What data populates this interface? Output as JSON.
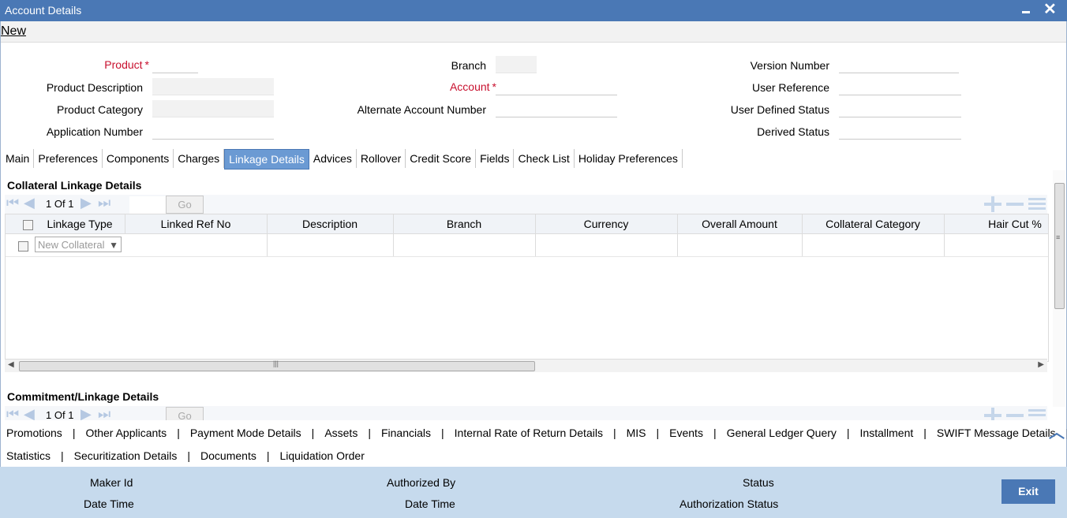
{
  "window": {
    "title": "Account Details"
  },
  "toolbar": {
    "new_label": "New"
  },
  "header_fields": {
    "product": {
      "label": "Product",
      "value": ""
    },
    "product_description": {
      "label": "Product Description",
      "value": ""
    },
    "product_category": {
      "label": "Product Category",
      "value": ""
    },
    "application_number": {
      "label": "Application Number",
      "value": ""
    },
    "branch": {
      "label": "Branch",
      "value": ""
    },
    "account": {
      "label": "Account",
      "value": ""
    },
    "alternate_account_number": {
      "label": "Alternate Account Number",
      "value": ""
    },
    "version_number": {
      "label": "Version Number",
      "value": ""
    },
    "user_reference": {
      "label": "User Reference",
      "value": ""
    },
    "user_defined_status": {
      "label": "User Defined Status",
      "value": ""
    },
    "derived_status": {
      "label": "Derived Status",
      "value": ""
    },
    "required_marker": "*"
  },
  "tabs": [
    {
      "label": "Main"
    },
    {
      "label": "Preferences"
    },
    {
      "label": "Components"
    },
    {
      "label": "Charges"
    },
    {
      "label": "Linkage Details",
      "active": true
    },
    {
      "label": "Advices"
    },
    {
      "label": "Rollover"
    },
    {
      "label": "Credit Score"
    },
    {
      "label": "Fields"
    },
    {
      "label": "Check List"
    },
    {
      "label": "Holiday Preferences"
    }
  ],
  "collateral": {
    "title": "Collateral Linkage Details",
    "page_current": "1",
    "page_of": "Of",
    "page_total": "1",
    "go_label": "Go",
    "columns": [
      "Linkage Type",
      "Linked Ref No",
      "Description",
      "Branch",
      "Currency",
      "Overall Amount",
      "Collateral Category",
      "Hair Cut %"
    ],
    "row": {
      "linkage_type": "New Collateral"
    }
  },
  "commitment": {
    "title": "Commitment/Linkage Details",
    "page_current": "1",
    "page_of": "Of",
    "page_total": "1",
    "go_label": "Go"
  },
  "bottom_links_row1": [
    "Promotions",
    "Other Applicants",
    "Payment Mode Details",
    "Assets",
    "Financials",
    "Internal Rate of Return Details",
    "MIS",
    "Events",
    "General Ledger Query",
    "Installment",
    "SWIFT Message Details"
  ],
  "bottom_links_row2": [
    "Statistics",
    "Securitization Details",
    "Documents",
    "Liquidation Order"
  ],
  "link_separator": "|",
  "footer": {
    "maker_id": "Maker Id",
    "date_time_1": "Date Time",
    "authorized_by": "Authorized By",
    "date_time_2": "Date Time",
    "status": "Status",
    "authorization_status": "Authorization Status",
    "exit_label": "Exit"
  },
  "colors": {
    "title_bar": "#4a78b5",
    "active_tab": "#6b9ad3",
    "footer_bg": "#c6daed",
    "required": "#c8102e"
  }
}
